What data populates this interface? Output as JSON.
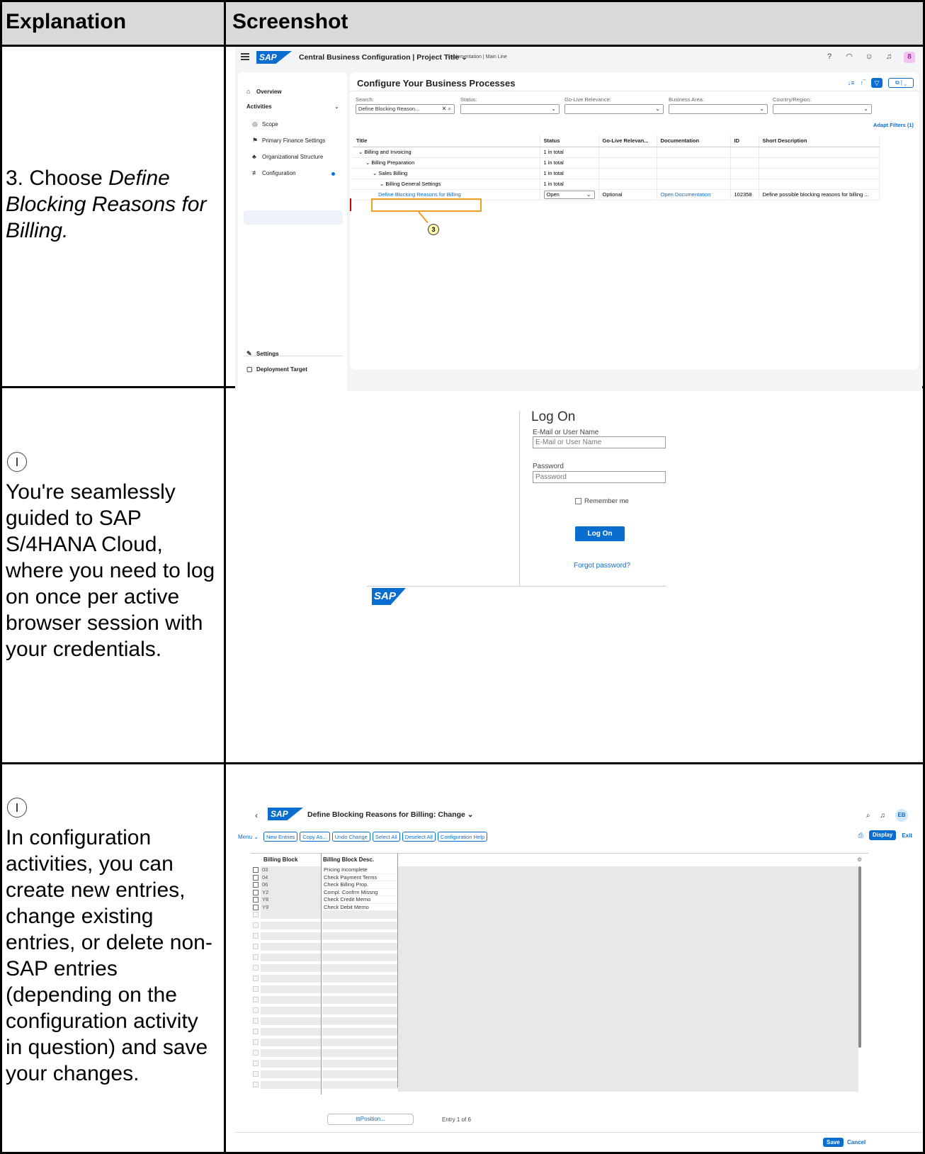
{
  "headers": {
    "explanation": "Explanation",
    "screenshot": "Screenshot"
  },
  "rows": [
    {
      "text_prefix": "3. Choose ",
      "text_italic": "Define Blocking Reasons for Billing."
    },
    {
      "text": "You're seamlessly guided to SAP S/4HANA Cloud, where you need to log on once per active browser session with your credentials."
    },
    {
      "text": "In configuration activities, you can create new entries, change existing entries, or delete non-SAP entries (depending on the configuration activity in question) and save your changes."
    }
  ],
  "cbc": {
    "logo": "SAP",
    "app_title": "Central Business Configuration | Project Title ⌄",
    "subtitle": "Implementation | Main Line",
    "avatar": "8",
    "nav": {
      "overview": "Overview",
      "activities": "Activities",
      "scope": "Scope",
      "primary_finance": "Primary Finance Settings",
      "org_structure": "Organizational Structure",
      "configuration": "Configuration",
      "settings": "Settings",
      "deployment": "Deployment Target"
    },
    "panel_title": "Configure Your Business Processes",
    "filters": {
      "search_label": "Search:",
      "search_value": "Define Blocking Reason...",
      "status_label": "Status:",
      "golive_label": "Go-Live Relevance:",
      "area_label": "Business Area:",
      "country_label": "Country/Region:"
    },
    "adapt_filters": "Adapt Filters (1)",
    "table_headers": [
      "Title",
      "Status",
      "Go-Live Relevan...",
      "Documentation",
      "ID",
      "Short Description"
    ],
    "table_rows": [
      {
        "title": "Billing and Invoicing",
        "status": "1 in total"
      },
      {
        "title": "Billing Preparation",
        "status": "1 in total"
      },
      {
        "title": "Sales Billing",
        "status": "1 in total"
      },
      {
        "title": "Billing General Settings",
        "status": "1 in total"
      }
    ],
    "activity_row": {
      "title": "Define Blocking Reasons for Billing",
      "status": "Open",
      "golive": "Optional",
      "documentation": "Open Documentation",
      "id": "102358",
      "description": "Define possible blocking reasons for billing ..."
    },
    "callout": "3"
  },
  "logon": {
    "title": "Log On",
    "user_label": "E-Mail or User Name",
    "user_placeholder": "E-Mail or User Name",
    "password_label": "Password",
    "password_placeholder": "Password",
    "remember": "Remember me",
    "button": "Log On",
    "forgot": "Forgot password?",
    "logo": "SAP"
  },
  "config": {
    "logo": "SAP",
    "title": "Define Blocking Reasons for Billing: Change ⌄",
    "avatar": "EB",
    "menu": "Menu ⌄",
    "buttons": [
      "New Entries",
      "Copy As...",
      "Undo Change",
      "Select All",
      "Deselect All",
      "Configuration Help"
    ],
    "display": "Display",
    "exit": "Exit",
    "col1": "Billing Block",
    "col2": "Billing Block Desc.",
    "entries": [
      {
        "code": "03",
        "desc": "Pricing Incomplete"
      },
      {
        "code": "04",
        "desc": "Check Payment Terms"
      },
      {
        "code": "06",
        "desc": "Check Billing Prop."
      },
      {
        "code": "Y2",
        "desc": "Compl. Confrm Missng"
      },
      {
        "code": "Y8",
        "desc": "Check Credit Memo"
      },
      {
        "code": "Y9",
        "desc": "Check Debit Memo"
      }
    ],
    "position": "Position...",
    "entry_count": "Entry 1 of 6",
    "save": "Save",
    "cancel": "Cancel"
  }
}
